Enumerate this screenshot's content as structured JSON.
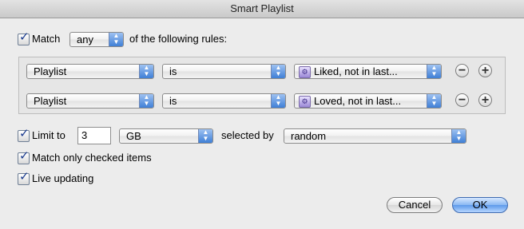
{
  "window": {
    "title": "Smart Playlist"
  },
  "match_row": {
    "match_label": "Match",
    "match_checked": true,
    "match_mode": "any",
    "suffix": "of the following rules:"
  },
  "rules": [
    {
      "field": "Playlist",
      "operator": "is",
      "value": "Liked, not in last...",
      "value_icon": "smart-playlist-icon"
    },
    {
      "field": "Playlist",
      "operator": "is",
      "value": "Loved, not in last...",
      "value_icon": "smart-playlist-icon"
    }
  ],
  "limit": {
    "label": "Limit to",
    "checked": true,
    "amount": "3",
    "unit": "GB",
    "selected_by_label": "selected by",
    "selected_by": "random"
  },
  "options": {
    "match_checked_label": "Match only checked items",
    "match_checked_checked": true,
    "live_updating_label": "Live updating",
    "live_updating_checked": true
  },
  "buttons": {
    "cancel": "Cancel",
    "ok": "OK"
  },
  "colors": {
    "accent": "#3f7fd6",
    "default_button": "#5d99ea"
  }
}
